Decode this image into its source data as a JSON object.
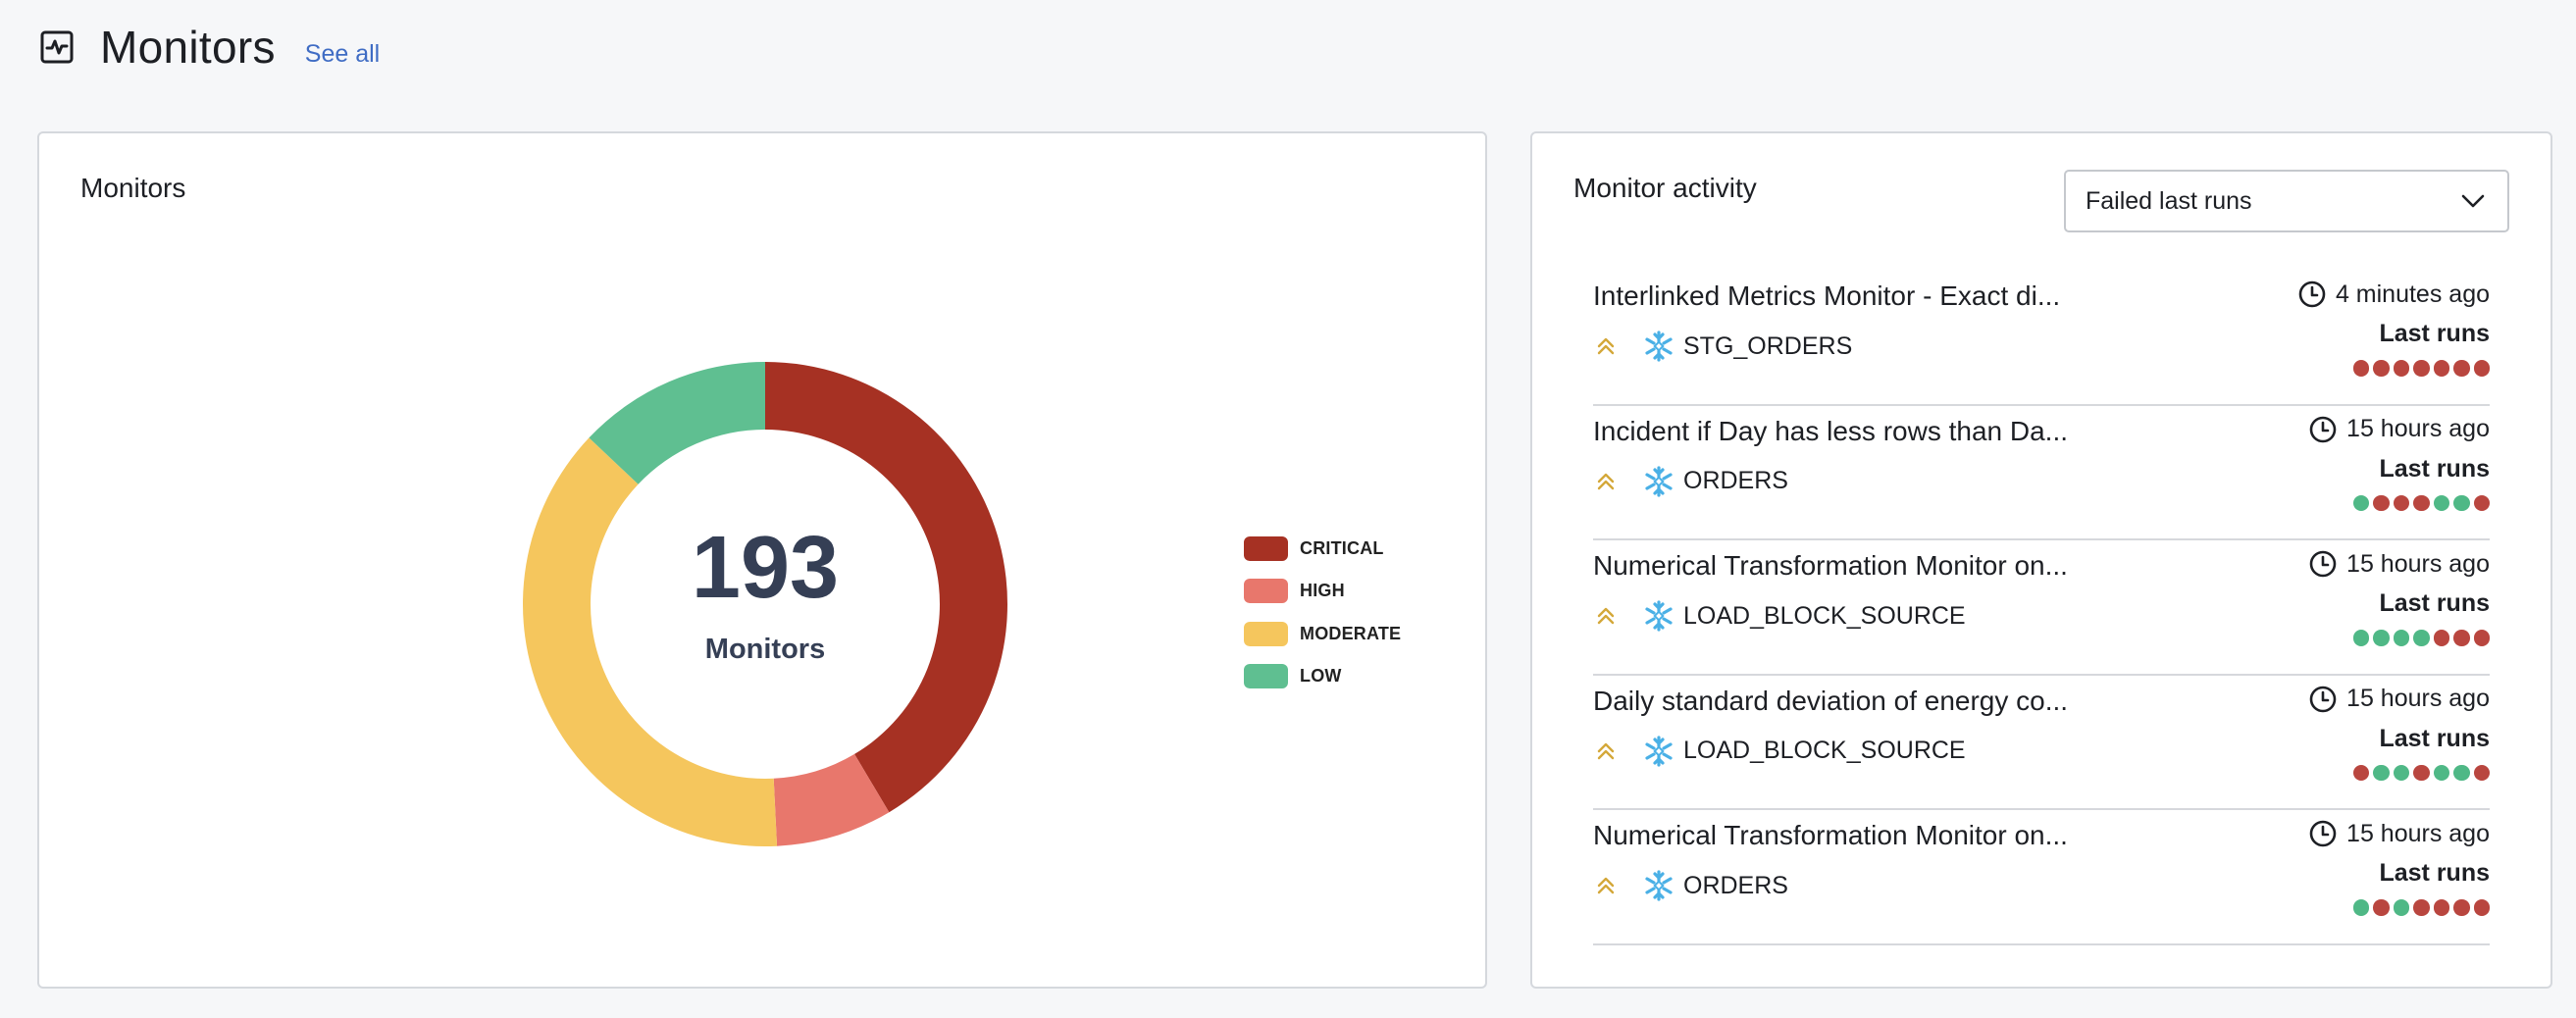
{
  "header": {
    "icon": "activity-monitor-icon",
    "title": "Monitors",
    "see_all_label": "See all"
  },
  "monitors_card": {
    "title": "Monitors",
    "center_total": "193",
    "center_caption": "Monitors"
  },
  "chart_data": {
    "type": "pie",
    "variant": "donut",
    "title": "Monitors",
    "total": 193,
    "center_label": "Monitors",
    "categories": [
      "CRITICAL",
      "HIGH",
      "MODERATE",
      "LOW"
    ],
    "values": [
      80,
      15,
      73,
      25
    ],
    "colors": [
      "#a63123",
      "#e8776c",
      "#f5c65d",
      "#5fbf91"
    ],
    "start_angle_deg": 0,
    "direction": "clockwise",
    "legend_position": "right"
  },
  "activity_card": {
    "title": "Monitor activity",
    "filter": {
      "selected": "Failed last runs",
      "icon": "chevron-down-icon"
    },
    "last_runs_label": "Last runs",
    "status_colors": {
      "success": "#4fb886",
      "failure": "#b9463f"
    },
    "priority_color": "#d4a83a",
    "snowflake_color": "#4ab0e6",
    "items": [
      {
        "name": "Interlinked Metrics Monitor - Exact di...",
        "table": "STG_ORDERS",
        "time": "4 minutes ago",
        "runs": [
          "failure",
          "failure",
          "failure",
          "failure",
          "failure",
          "failure",
          "failure"
        ]
      },
      {
        "name": "Incident if Day has less rows than Da...",
        "table": "ORDERS",
        "time": "15 hours ago",
        "runs": [
          "success",
          "failure",
          "failure",
          "failure",
          "success",
          "success",
          "failure"
        ]
      },
      {
        "name": "Numerical Transformation Monitor on...",
        "table": "LOAD_BLOCK_SOURCE",
        "time": "15 hours ago",
        "runs": [
          "success",
          "success",
          "success",
          "success",
          "failure",
          "failure",
          "failure"
        ]
      },
      {
        "name": "Daily standard deviation of energy co...",
        "table": "LOAD_BLOCK_SOURCE",
        "time": "15 hours ago",
        "runs": [
          "failure",
          "success",
          "success",
          "failure",
          "success",
          "success",
          "failure"
        ]
      },
      {
        "name": "Numerical Transformation Monitor on...",
        "table": "ORDERS",
        "time": "15 hours ago",
        "runs": [
          "success",
          "failure",
          "success",
          "failure",
          "failure",
          "failure",
          "failure"
        ]
      }
    ]
  }
}
